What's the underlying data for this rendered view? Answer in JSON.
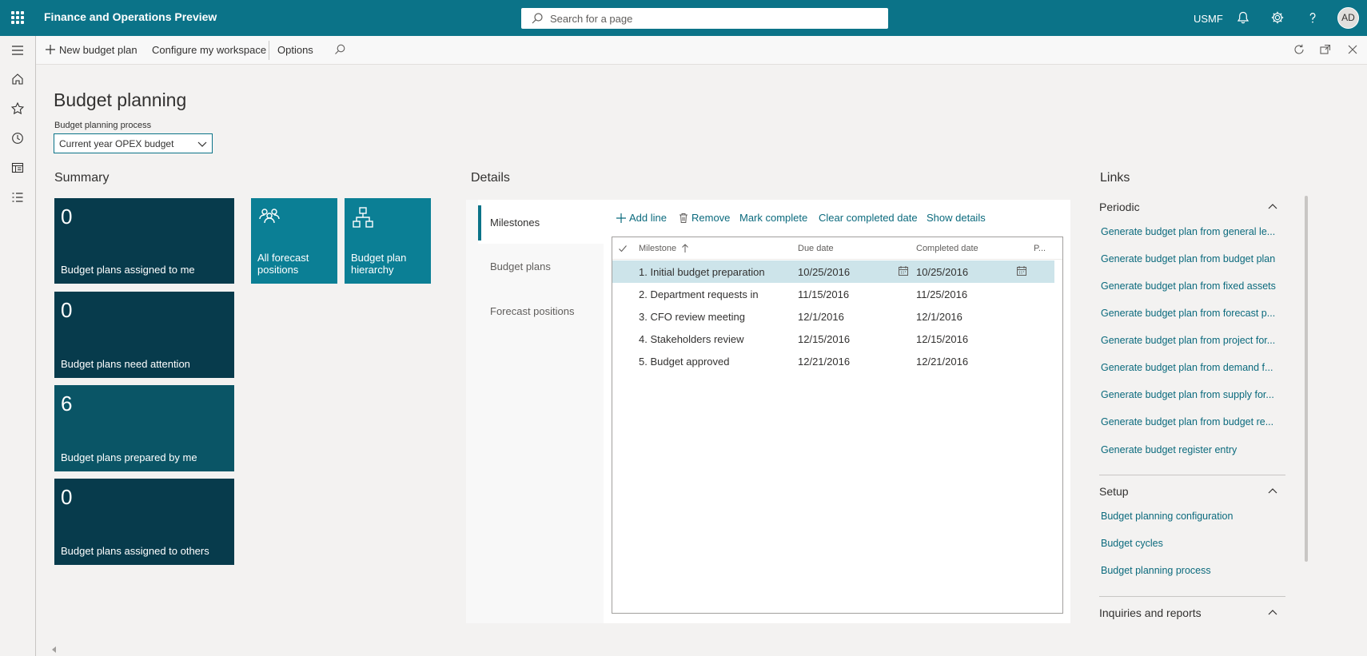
{
  "topbar": {
    "app_title": "Finance and Operations Preview",
    "search_placeholder": "Search for a page",
    "company": "USMF",
    "avatar_initials": "AD",
    "colors": {
      "brand": "#0b7388"
    }
  },
  "actionbar": {
    "new_budget_plan": "New budget plan",
    "configure_workspace": "Configure my workspace",
    "options": "Options"
  },
  "page": {
    "title": "Budget planning",
    "process_label": "Budget planning process",
    "process_value": "Current year OPEX budget"
  },
  "summary": {
    "heading": "Summary",
    "tiles": [
      {
        "count": "0",
        "label": "Budget plans assigned to me"
      },
      {
        "count": "0",
        "label": "Budget plans need attention"
      },
      {
        "count": "6",
        "label": "Budget plans prepared by me"
      },
      {
        "count": "0",
        "label": "Budget plans assigned to others"
      }
    ],
    "link_tiles": [
      {
        "icon": "people-icon",
        "label": "All forecast positions"
      },
      {
        "icon": "hierarchy-icon",
        "label": "Budget plan hierarchy"
      }
    ]
  },
  "details": {
    "heading": "Details",
    "tabs": [
      "Milestones",
      "Budget plans",
      "Forecast positions"
    ],
    "toolbar": {
      "add_line": "Add line",
      "remove": "Remove",
      "mark_complete": "Mark complete",
      "clear_completed_date": "Clear completed date",
      "show_details": "Show details"
    },
    "columns": {
      "milestone": "Milestone",
      "due_date": "Due date",
      "completed_date": "Completed date",
      "p": "P..."
    },
    "rows": [
      {
        "milestone": "1. Initial budget preparation",
        "due": "10/25/2016",
        "completed": "10/25/2016"
      },
      {
        "milestone": "2. Department requests in",
        "due": "11/15/2016",
        "completed": "11/25/2016"
      },
      {
        "milestone": "3. CFO review meeting",
        "due": "12/1/2016",
        "completed": "12/1/2016"
      },
      {
        "milestone": "4. Stakeholders review",
        "due": "12/15/2016",
        "completed": "12/15/2016"
      },
      {
        "milestone": "5. Budget approved",
        "due": "12/21/2016",
        "completed": "12/21/2016"
      }
    ]
  },
  "links": {
    "heading": "Links",
    "periodic": {
      "title": "Periodic",
      "items": [
        "Generate budget plan from general le...",
        "Generate budget plan from budget plan",
        "Generate budget plan from fixed assets",
        "Generate budget plan from forecast p...",
        "Generate budget plan from project for...",
        "Generate budget plan from demand f...",
        "Generate budget plan from supply for...",
        "Generate budget plan from budget re...",
        "Generate budget register entry"
      ]
    },
    "setup": {
      "title": "Setup",
      "items": [
        "Budget planning configuration",
        "Budget cycles",
        "Budget planning process"
      ]
    },
    "inquiries": {
      "title": "Inquiries and reports"
    }
  }
}
